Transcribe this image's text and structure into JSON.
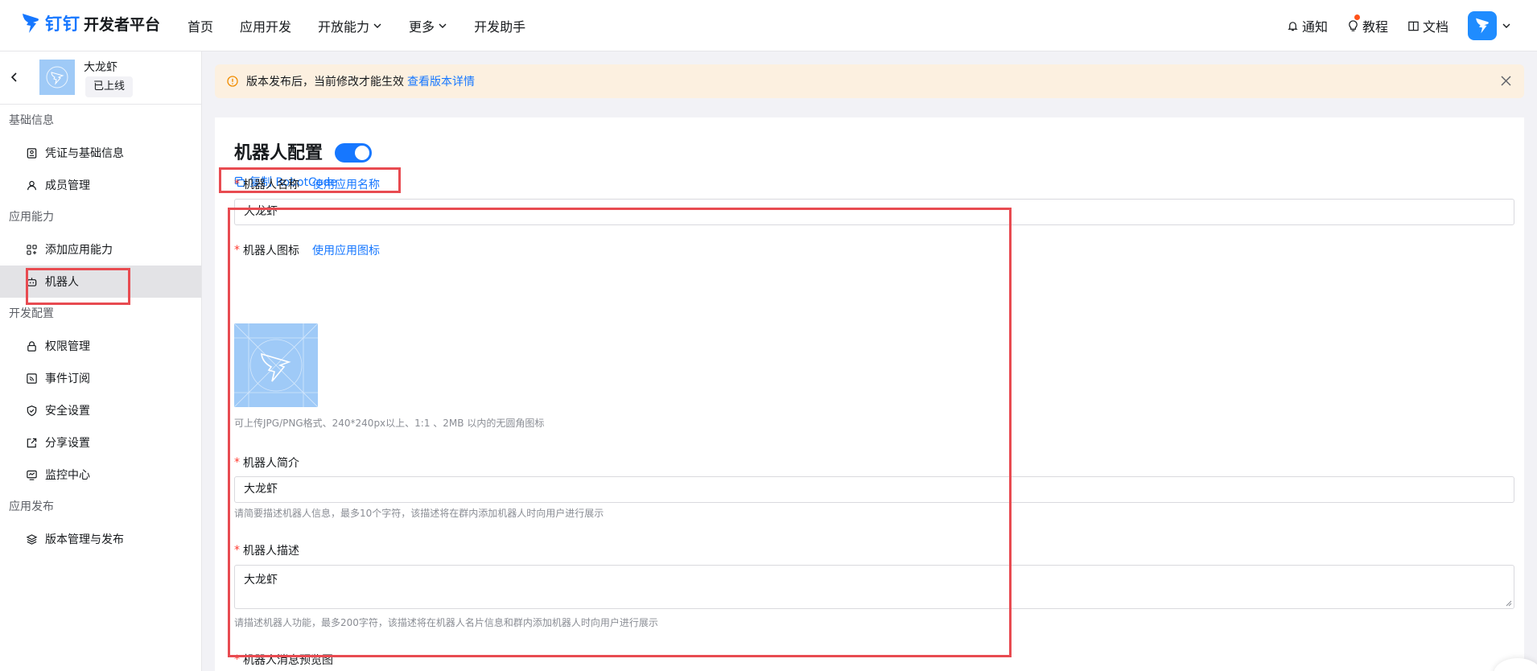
{
  "header": {
    "brand_ding": "钉钉",
    "brand_dev": "开发者平台",
    "nav": [
      {
        "label": "首页"
      },
      {
        "label": "应用开发"
      },
      {
        "label": "开放能力"
      },
      {
        "label": "更多"
      },
      {
        "label": "开发助手"
      }
    ],
    "right": {
      "notify": "通知",
      "tutorial": "教程",
      "docs": "文档"
    }
  },
  "sidebar": {
    "app_name": "大龙虾",
    "app_status": "已上线",
    "sections": [
      {
        "title": "基础信息",
        "items": [
          {
            "label": "凭证与基础信息"
          },
          {
            "label": "成员管理"
          }
        ]
      },
      {
        "title": "应用能力",
        "items": [
          {
            "label": "添加应用能力"
          },
          {
            "label": "机器人"
          }
        ]
      },
      {
        "title": "开发配置",
        "items": [
          {
            "label": "权限管理"
          },
          {
            "label": "事件订阅"
          },
          {
            "label": "安全设置"
          },
          {
            "label": "分享设置"
          },
          {
            "label": "监控中心"
          }
        ]
      },
      {
        "title": "应用发布",
        "items": [
          {
            "label": "版本管理与发布"
          }
        ]
      }
    ],
    "active_item": "机器人"
  },
  "notice": {
    "text": "版本发布后，当前修改才能生效",
    "link": "查看版本详情"
  },
  "robot_config": {
    "title": "机器人配置",
    "enabled": true,
    "copy_robot_code": "复制 RobotCode",
    "name": {
      "label": "机器人名称",
      "link": "使用应用名称",
      "value": "大龙虾"
    },
    "icon": {
      "label": "机器人图标",
      "link": "使用应用图标",
      "hint": "可上传JPG/PNG格式、240*240px以上、1:1 、2MB 以内的无圆角图标"
    },
    "intro": {
      "label": "机器人简介",
      "value": "大龙虾",
      "hint": "请简要描述机器人信息，最多10个字符，该描述将在群内添加机器人时向用户进行展示"
    },
    "description": {
      "label": "机器人描述",
      "value": "大龙虾",
      "hint": "请描述机器人功能，最多200字符，该描述将在机器人名片信息和群内添加机器人时向用户进行展示"
    },
    "preview_label": "机器人消息预览图"
  },
  "colors": {
    "accent": "#1677ff",
    "required": "#ff3b30",
    "highlight": "#e84b51",
    "notice_bg": "#fcf0e0",
    "app_icon_bg": "#9fcaf7"
  },
  "icons": {
    "logo": "dingtalk-logo-icon",
    "notify": "bell-icon",
    "tutorial": "lightbulb-icon",
    "docs": "book-icon",
    "warning": "warning-circle-icon",
    "close": "close-icon",
    "copy": "copy-icon"
  }
}
